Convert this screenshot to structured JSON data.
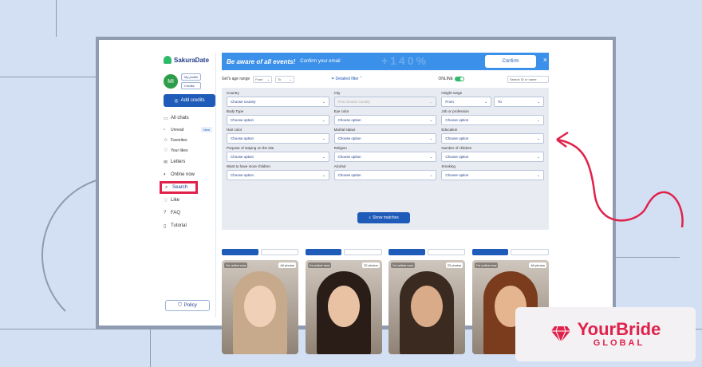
{
  "app": {
    "logo_text": "SakuraDate"
  },
  "sidebar": {
    "avatar_initials": "MI",
    "my_profile_label": "My profile",
    "credits_label": "Credits",
    "add_credits_label": "Add credits",
    "items": [
      {
        "label": "All chats",
        "icon": "chat-icon"
      },
      {
        "label": "Unread",
        "icon": "unread-icon",
        "badge": "New"
      },
      {
        "label": "Favorites",
        "icon": "star-icon"
      },
      {
        "label": "Your likes",
        "icon": "heart-icon"
      },
      {
        "label": "Letters",
        "icon": "mail-icon"
      },
      {
        "label": "Online now",
        "icon": "toggle-icon"
      },
      {
        "label": "Search",
        "icon": "search-icon"
      },
      {
        "label": "Like",
        "icon": "heart-icon"
      },
      {
        "label": "FAQ",
        "icon": "question-icon"
      },
      {
        "label": "Tutorial",
        "icon": "phone-icon"
      }
    ],
    "policy_label": "Policy"
  },
  "banner": {
    "title": "Be aware of all events!",
    "subtitle": "Confirm your email",
    "deco_text": "+140%",
    "confirm_label": "Confirm",
    "close": "×"
  },
  "filters": {
    "age_label": "Girl's age range",
    "age_from": "From",
    "age_to": "To",
    "detailed_label": "Detailed filter",
    "online_label": "ONLINE",
    "id_placeholder": "Search ID or name",
    "fields": [
      {
        "label": "Country",
        "value": "Choose country",
        "disabled": false
      },
      {
        "label": "City",
        "value": "First choose country",
        "disabled": true
      },
      {
        "label": "Height range",
        "pair": [
          "From",
          "To"
        ]
      },
      {
        "label": "Body Type",
        "value": "Choose option"
      },
      {
        "label": "Eye color",
        "value": "Choose option"
      },
      {
        "label": "Job or profession",
        "value": "Choose option"
      },
      {
        "label": "Hair color",
        "value": "Choose option"
      },
      {
        "label": "Marital status",
        "value": "Choose option"
      },
      {
        "label": "Education",
        "value": "Choose option"
      },
      {
        "label": "Purpose of staying on the site",
        "value": "Choose option"
      },
      {
        "label": "Religion",
        "value": "Choose option"
      },
      {
        "label": "Number of children",
        "value": "Choose option"
      },
      {
        "label": "Want to have more children",
        "value": "Choose option"
      },
      {
        "label": "Alcohol",
        "value": "Choose option"
      },
      {
        "label": "Smoking",
        "value": "Choose option"
      }
    ],
    "show_matches_label": "Show matches"
  },
  "cards": [
    {
      "status": "I'm online now",
      "photos": "All photos",
      "hair": "#c7a98c",
      "skin": "#f1d0b8"
    },
    {
      "status": "I'm online now",
      "photos": "22 photos",
      "hair": "#2a1d18",
      "skin": "#e8c2a2"
    },
    {
      "status": "I'm online now",
      "photos": "22 photos",
      "hair": "#3a2a20",
      "skin": "#d9ab88"
    },
    {
      "status": "I'm online now",
      "photos": "All photos",
      "hair": "#7a3c1c",
      "skin": "#e4b58e"
    }
  ],
  "brand": {
    "name": "YourBride",
    "sub": "GLOBAL"
  },
  "colors": {
    "accent": "#1f5bb8",
    "highlight": "#e0224b",
    "background": "#d3e0f4"
  }
}
